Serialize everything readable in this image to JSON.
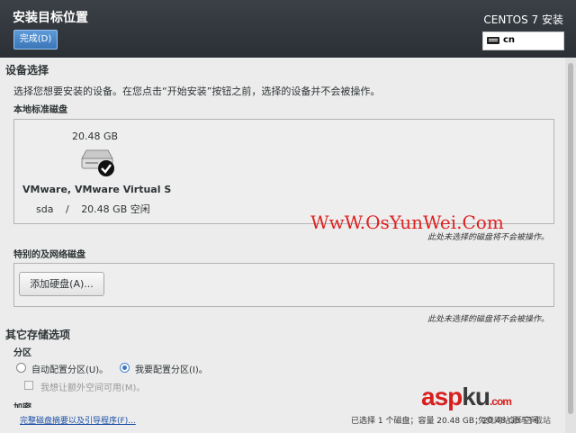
{
  "header": {
    "title": "安装目标位置",
    "done_label": "完成(D)",
    "product": "CENTOS 7 安装",
    "keyboard_layout": "cn"
  },
  "device_selection": {
    "heading": "设备选择",
    "description": "选择您想要安装的设备。在您点击“开始安装”按钮之前，选择的设备并不会被操作。",
    "local_heading": "本地标准磁盘",
    "disk": {
      "size": "20.48 GB",
      "name": "VMware, VMware Virtual S",
      "dev": "sda",
      "slash": "/",
      "free": "20.48 GB 空闲",
      "selected": true
    },
    "local_note": "此处未选择的磁盘将不会被操作。",
    "special_heading": "特别的及网络磁盘",
    "add_disk_label": "添加硬盘(A)...",
    "special_note": "此处未选择的磁盘将不会被操作。"
  },
  "storage_options": {
    "heading": "其它存储选项",
    "partition_heading": "分区",
    "auto_label": "自动配置分区(U)。",
    "manual_label": "我要配置分区(I)。",
    "selected": "manual",
    "extra_space_label": "我想让额外空间可用(M)。",
    "next_heading_partial": "加密"
  },
  "footer": {
    "summary_link": "完整磁盘摘要以及引导程序(F)...",
    "status": "已选择 1 个磁盘；容量 20.48 GB；20.48 GB 空闲"
  },
  "watermarks": {
    "site": "WwW.OsYunWei.Com",
    "logo_a": "asp",
    "logo_b": "ku",
    "logo_c": ".com",
    "logo_sub": "免费网站源码下载站"
  },
  "colors": {
    "header_bg": "#2f3439",
    "accent": "#3b78c0",
    "watermark_red": "#e02020"
  }
}
